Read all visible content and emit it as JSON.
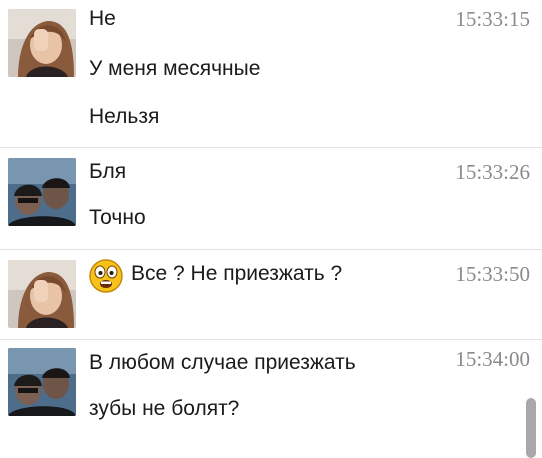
{
  "messages": [
    {
      "sender": "girl",
      "time": "15:33:15",
      "lines": [
        "Не",
        "У меня месячные",
        "Нельзя"
      ]
    },
    {
      "sender": "guys",
      "time": "15:33:26",
      "lines": [
        "Бля",
        "Точно"
      ]
    },
    {
      "sender": "girl",
      "time": "15:33:50",
      "lines": [
        "Все ? Не приезжать ?"
      ],
      "emoji": "surprised-face-emoji"
    },
    {
      "sender": "guys",
      "time": "15:34:00",
      "lines": [
        "В любом случае приезжать",
        "зубы не болят?"
      ]
    }
  ],
  "colors": {
    "separator": "#e3e3e3",
    "timestamp": "#8a8a8a",
    "text": "#1b1b1b",
    "scrollbar": "#a9a9a9",
    "emoji_face": "#f7c21a"
  }
}
